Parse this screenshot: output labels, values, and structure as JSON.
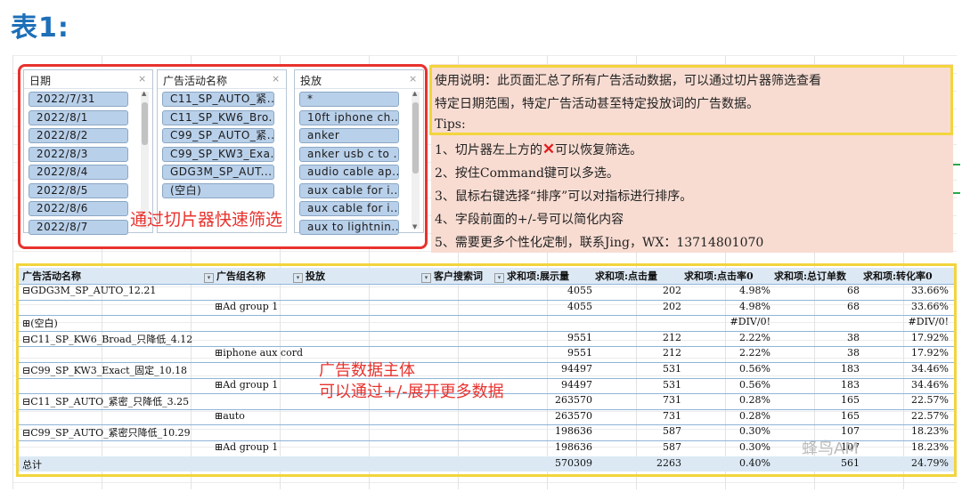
{
  "heading": "表1:",
  "slicers": [
    {
      "title": "日期",
      "items": [
        "2022/7/31",
        "2022/8/1",
        "2022/8/2",
        "2022/8/3",
        "2022/8/4",
        "2022/8/5",
        "2022/8/6",
        "2022/8/7"
      ]
    },
    {
      "title": "广告活动名称",
      "items": [
        "C11_SP_AUTO_紧...",
        "C11_SP_KW6_Bro...",
        "C99_SP_AUTO_紧...",
        "C99_SP_KW3_Exa...",
        "GDG3M_SP_AUT...",
        "(空白)"
      ]
    },
    {
      "title": "投放",
      "items": [
        "*",
        "10ft iphone ch...",
        "anker",
        "anker usb c to ...",
        "audio cable ap...",
        "aux cable for i...",
        "aux cable for i...",
        "aux to lightnin..."
      ]
    }
  ],
  "slicer_note": "通过切片器快速筛选",
  "instructions": {
    "line1": "使用说明：此页面汇总了所有广告活动数据，可以通过切片器筛选查看",
    "line2": "特定日期范围，特定广告活动甚至特定投放词的广告数据。",
    "tips": "Tips:",
    "tip1_a": "1、切片器左上方的",
    "tip1_x": "✕",
    "tip1_b": "可以恢复筛选。",
    "tip2": "2、按住Command键可以多选。",
    "tip3": "3、鼠标右键选择“排序”可以对指标进行排序。",
    "tip4": "4、字段前面的+/-号可以简化内容",
    "tip5": "5、需要更多个性化定制，联系Jing，WX：13714801070"
  },
  "table": {
    "headers": [
      "广告活动名称",
      "广告组名称",
      "投放",
      "客户搜索词",
      "求和项:展示量",
      "求和项:点击量",
      "求和项:点击率0",
      "求和项:总订单数",
      "求和项:转化率0"
    ],
    "rows": [
      {
        "c0": "⊟GDG3M_SP_AUTO_12.21",
        "c1": "",
        "v": [
          "4055",
          "202",
          "4.98%",
          "68",
          "33.66%"
        ]
      },
      {
        "c0": "",
        "c1": "⊞Ad group 1",
        "v": [
          "4055",
          "202",
          "4.98%",
          "68",
          "33.66%"
        ]
      },
      {
        "c0": "⊞(空白)",
        "c1": "",
        "v": [
          "",
          "",
          "#DIV/0!",
          "",
          "#DIV/0!"
        ]
      },
      {
        "c0": "⊟C11_SP_KW6_Broad_只降低_4.12",
        "c1": "",
        "v": [
          "9551",
          "212",
          "2.22%",
          "38",
          "17.92%"
        ]
      },
      {
        "c0": "",
        "c1": "⊞iphone aux cord",
        "v": [
          "9551",
          "212",
          "2.22%",
          "38",
          "17.92%"
        ]
      },
      {
        "c0": "⊟C99_SP_KW3_Exact_固定_10.18",
        "c1": "",
        "v": [
          "94497",
          "531",
          "0.56%",
          "183",
          "34.46%"
        ]
      },
      {
        "c0": "",
        "c1": "⊞Ad group 1",
        "v": [
          "94497",
          "531",
          "0.56%",
          "183",
          "34.46%"
        ]
      },
      {
        "c0": "⊟C11_SP_AUTO_紧密_只降低_3.25",
        "c1": "",
        "v": [
          "263570",
          "731",
          "0.28%",
          "165",
          "22.57%"
        ]
      },
      {
        "c0": "",
        "c1": "⊞auto",
        "v": [
          "263570",
          "731",
          "0.28%",
          "165",
          "22.57%"
        ]
      },
      {
        "c0": "⊟C99_SP_AUTO_紧密只降低_10.29",
        "c1": "",
        "v": [
          "198636",
          "587",
          "0.30%",
          "107",
          "18.23%"
        ]
      },
      {
        "c0": "",
        "c1": "⊞Ad group 1",
        "v": [
          "198636",
          "587",
          "0.30%",
          "107",
          "18.23%"
        ]
      }
    ],
    "total": {
      "label": "总计",
      "v": [
        "570309",
        "2263",
        "0.40%",
        "561",
        "24.79%"
      ]
    }
  },
  "table_note_line1": "广告数据主体",
  "table_note_line2": "可以通过+/-展开更多数据",
  "watermark": "蜂鸟AM",
  "colors": {
    "accent_red": "#e8322d",
    "accent_yellow": "#f2d53c",
    "heading_blue": "#1d6fb8",
    "slicer_item": "#b9d0ea",
    "instr_bg": "#f8dcd2",
    "table_header": "#dce9f5"
  }
}
